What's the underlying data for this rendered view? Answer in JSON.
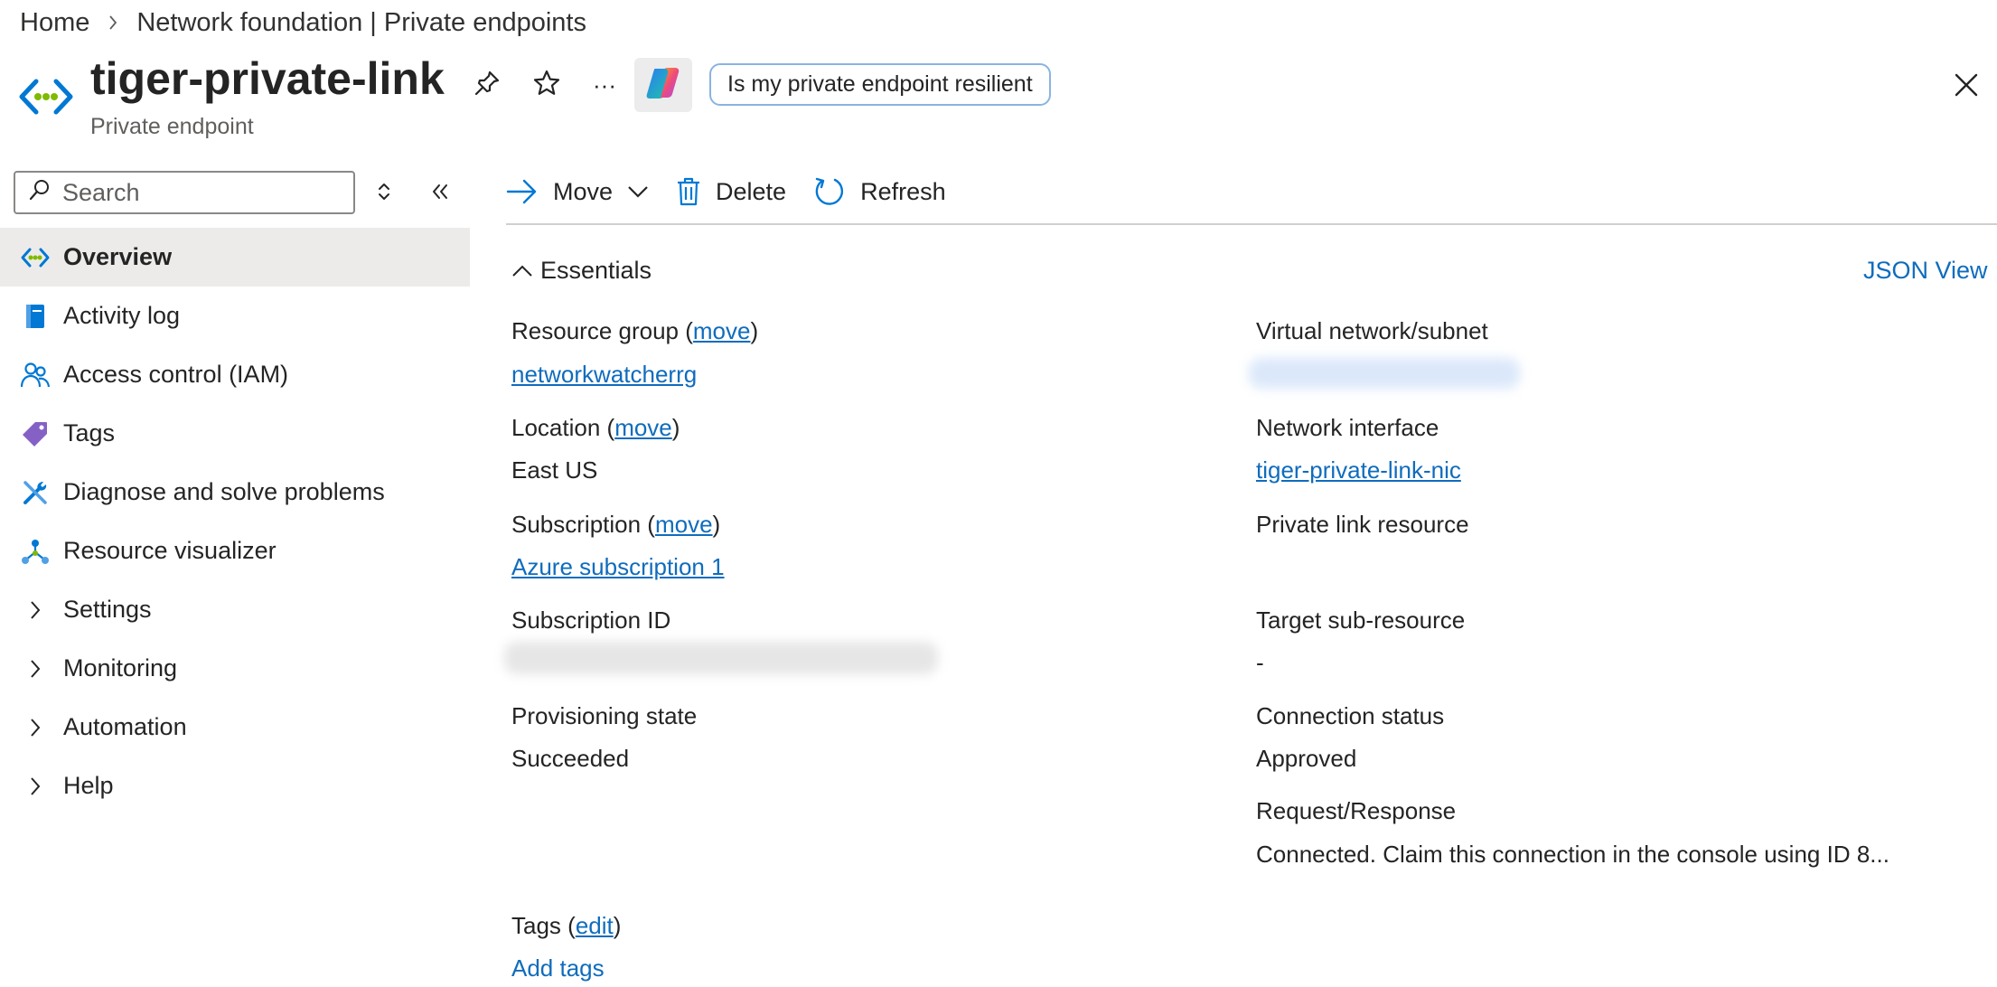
{
  "breadcrumb": {
    "home": "Home",
    "current": "Network foundation | Private endpoints"
  },
  "header": {
    "title": "tiger-private-link",
    "subtitle": "Private endpoint",
    "prompt_chip": "Is my private endpoint resilient",
    "more_label": "···"
  },
  "sidebar": {
    "search_placeholder": "Search",
    "items": [
      {
        "label": "Overview",
        "icon": "private-endpoint-icon"
      },
      {
        "label": "Activity log",
        "icon": "activity-log-icon"
      },
      {
        "label": "Access control (IAM)",
        "icon": "people-icon"
      },
      {
        "label": "Tags",
        "icon": "tag-icon"
      },
      {
        "label": "Diagnose and solve problems",
        "icon": "wrench-icon"
      },
      {
        "label": "Resource visualizer",
        "icon": "hierarchy-icon"
      },
      {
        "label": "Settings",
        "icon": "chevron-right-icon"
      },
      {
        "label": "Monitoring",
        "icon": "chevron-right-icon"
      },
      {
        "label": "Automation",
        "icon": "chevron-right-icon"
      },
      {
        "label": "Help",
        "icon": "chevron-right-icon"
      }
    ]
  },
  "toolbar": {
    "move": "Move",
    "delete": "Delete",
    "refresh": "Refresh"
  },
  "essentials": {
    "title": "Essentials",
    "json_view": "JSON View",
    "resource_group_label": "Resource group (",
    "resource_group_move": "move",
    "resource_group_close": ")",
    "resource_group_value": "networkwatcherrg",
    "location_label": "Location (",
    "location_move": "move",
    "location_close": ")",
    "location_value": "East US",
    "subscription_label": "Subscription (",
    "subscription_move": "move",
    "subscription_close": ")",
    "subscription_value": "Azure subscription 1",
    "subscription_id_label": "Subscription ID",
    "provisioning_label": "Provisioning state",
    "provisioning_value": "Succeeded",
    "vnet_label": "Virtual network/subnet",
    "nic_label": "Network interface",
    "nic_value": "tiger-private-link-nic",
    "pl_resource_label": "Private link resource",
    "target_sub_label": "Target sub-resource",
    "target_sub_value": "-",
    "conn_status_label": "Connection status",
    "conn_status_value": "Approved",
    "req_resp_label": "Request/Response",
    "req_resp_value": "Connected. Claim this connection in the console using ID 8...",
    "tags_label": "Tags (",
    "tags_edit": "edit",
    "tags_close": ")",
    "add_tags": "Add tags"
  },
  "colors": {
    "link": "#0f6cbd",
    "active_nav_bg": "#edebe9",
    "accent_blue": "#0078d4"
  }
}
